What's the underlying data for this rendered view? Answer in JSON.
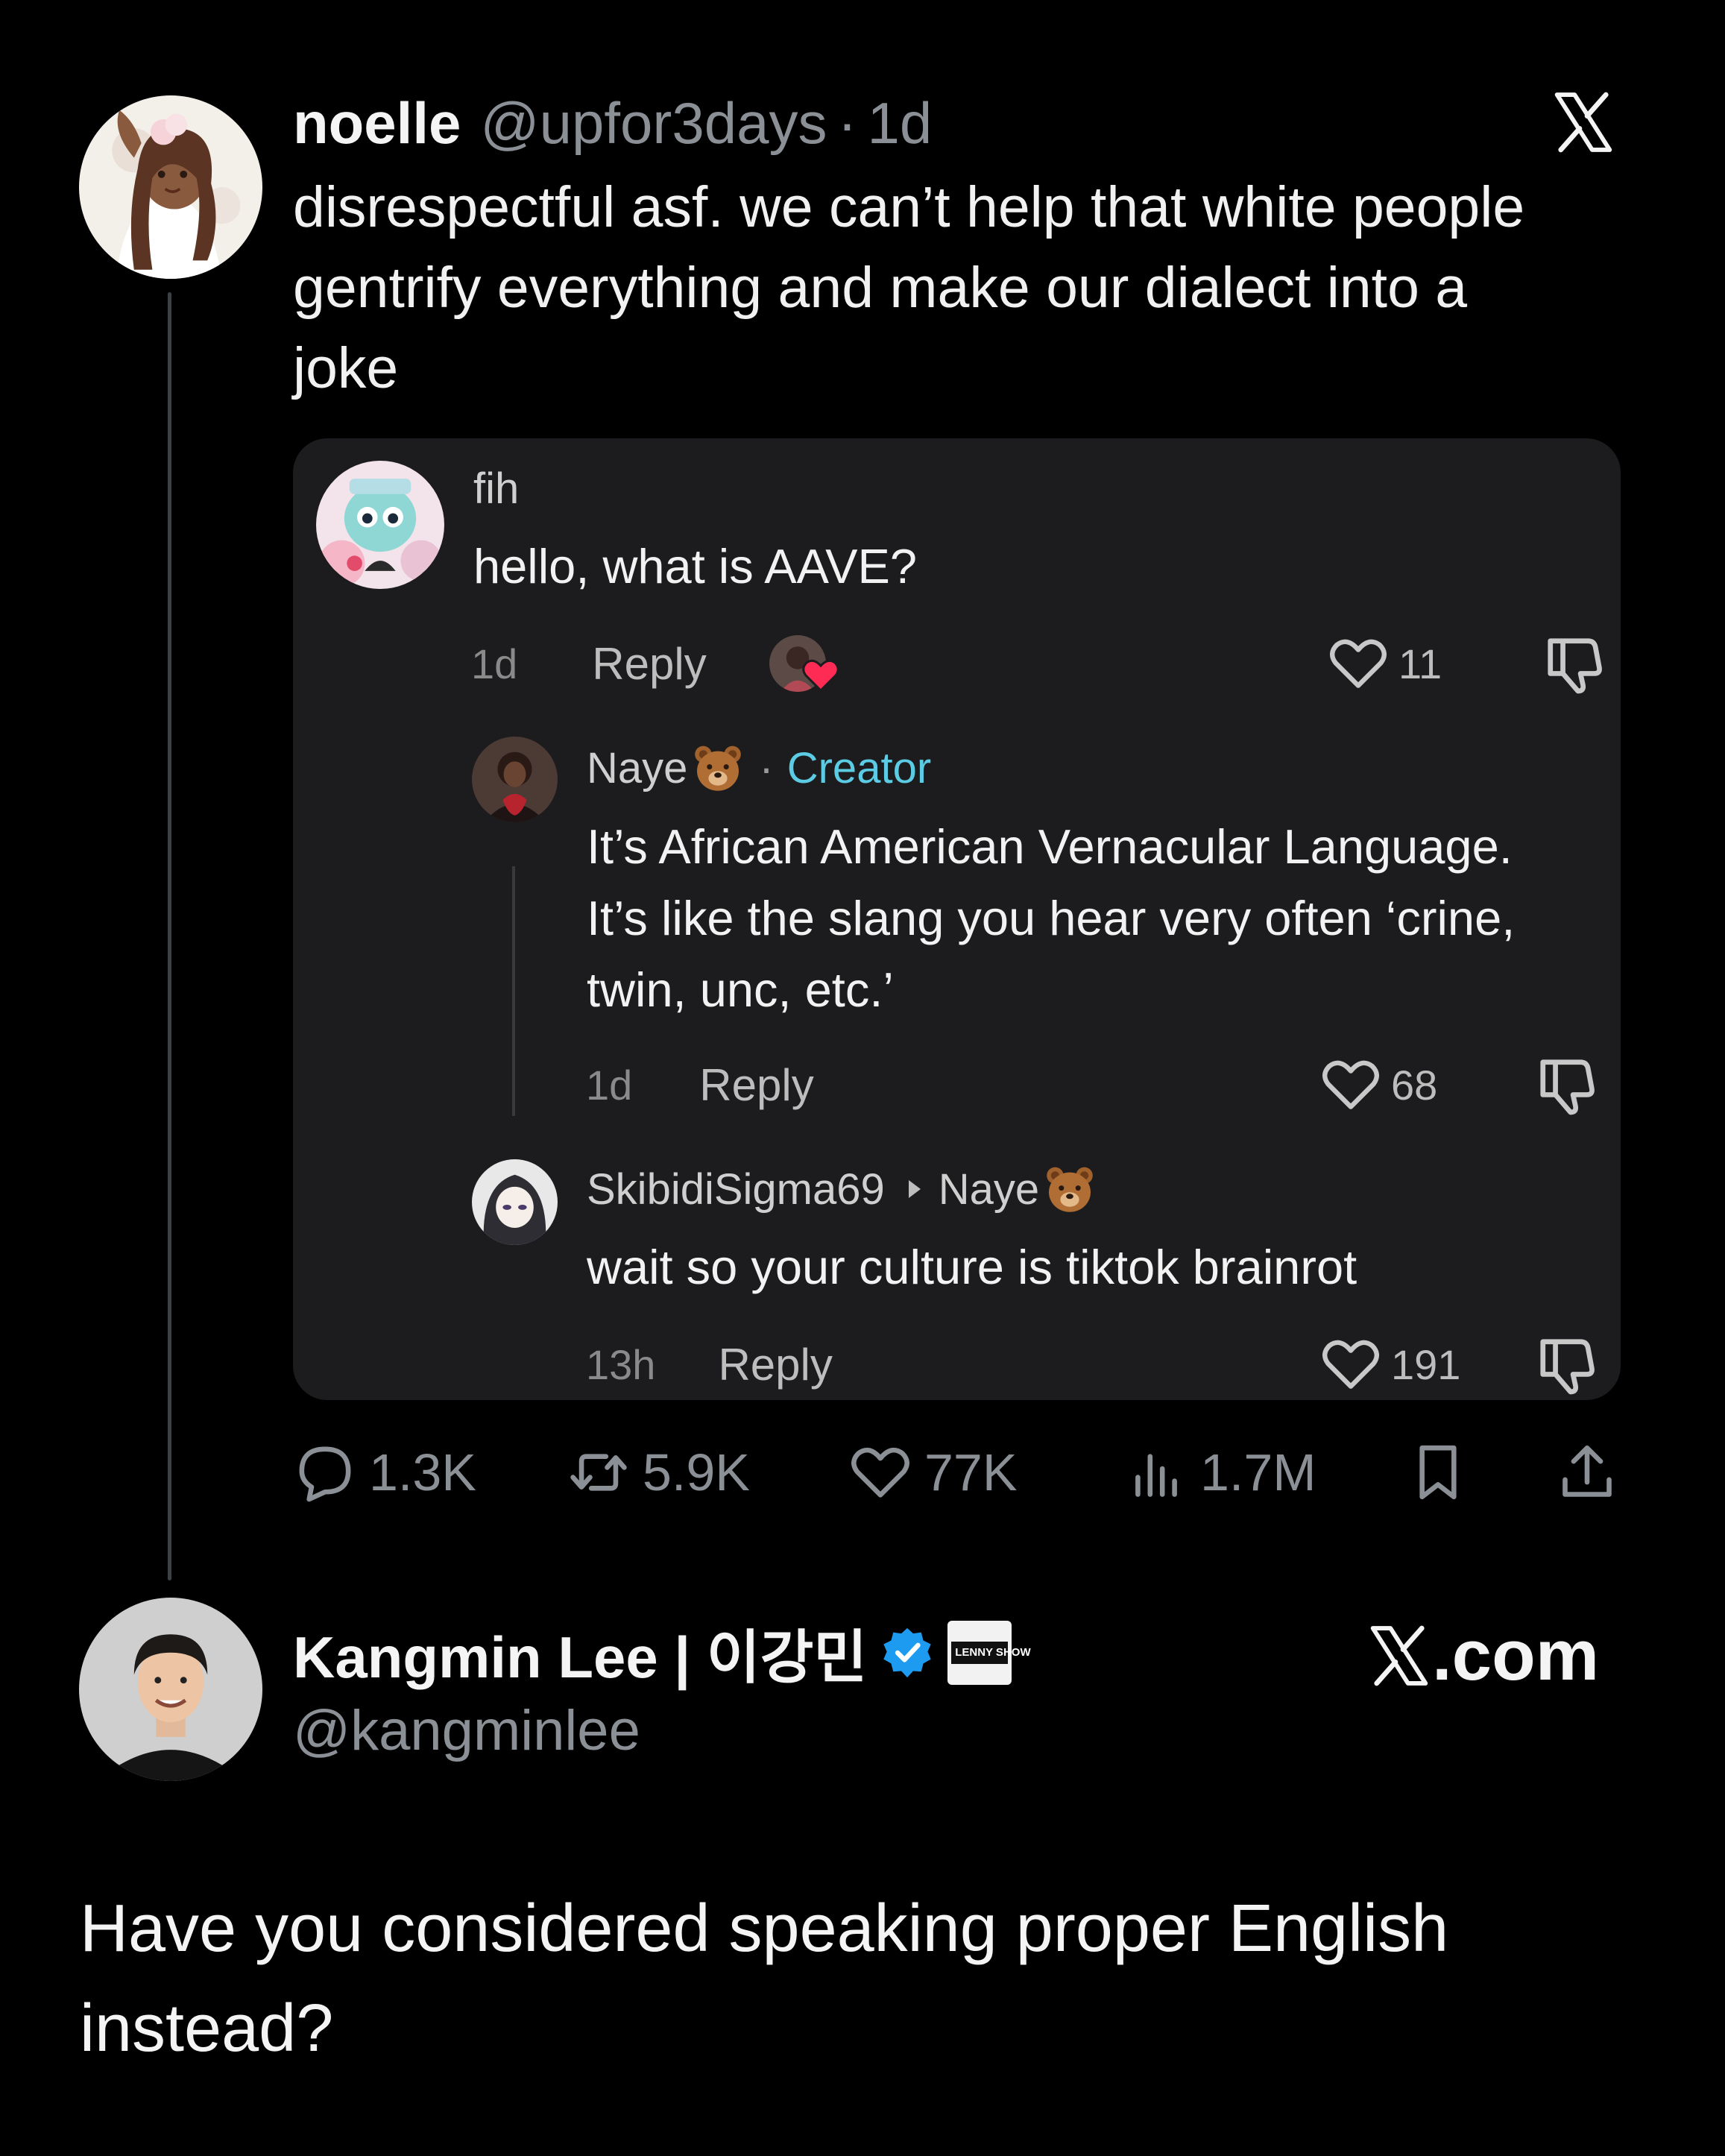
{
  "tweet": {
    "author_name": "noelle",
    "author_handle": "@upfor3days",
    "separator": "·",
    "time": "1d",
    "text": "disrespectful asf. we can’t help that white people gentrify everything and make our dialect into a joke",
    "brand_icon": "x-logo-icon"
  },
  "tiktok_card": {
    "comments": [
      {
        "user": "fih",
        "text": "hello, what is AAVE?",
        "time": "1d",
        "reply_label": "Reply",
        "likes": "11",
        "liked_by_creator": true
      },
      {
        "user": "Naye",
        "user_emoji": "bear",
        "separator": "·",
        "badge": "Creator",
        "text": "It’s African American Vernacular Language. It’s like the slang you hear very often ‘crine, twin, unc, etc.’",
        "time": "1d",
        "reply_label": "Reply",
        "likes": "68"
      },
      {
        "user": "SkibidiSigma69",
        "reply_to": "Naye",
        "reply_to_emoji": "bear",
        "text": "wait so your culture is tiktok brainrot",
        "time": "13h",
        "reply_label": "Reply",
        "likes": "191"
      }
    ]
  },
  "actions": {
    "replies": "1.3K",
    "reposts": "5.9K",
    "likes": "77K",
    "views": "1.7M"
  },
  "reply_tweet": {
    "author_name": "Kangmin Lee | 이강민",
    "verified": true,
    "badge_label": "LENNY SHOW",
    "author_handle": "@kangminlee",
    "brand_text": ".com",
    "text": "Have you considered speaking proper English instead?"
  },
  "colors": {
    "background": "#000000",
    "card": "#1c1c1e",
    "muted": "#8b9096",
    "creator": "#5ccbe4",
    "verified": "#1d9bf0",
    "heart": "#fe2c55"
  }
}
